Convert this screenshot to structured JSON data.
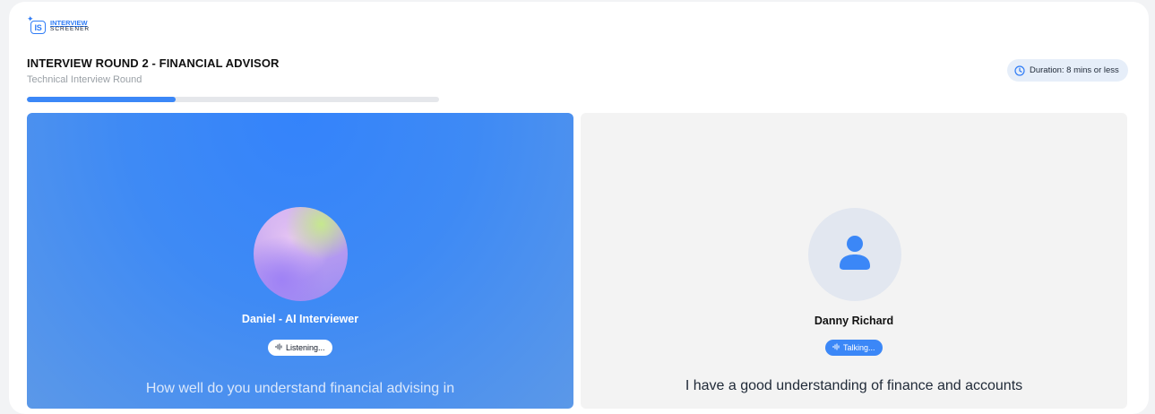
{
  "brand": {
    "logo_mark": "IS",
    "line1": "INTERVIEW",
    "line2": "SCREENER"
  },
  "header": {
    "title": "INTERVIEW ROUND 2 - FINANCIAL ADVISOR",
    "subtitle": "Technical Interview Round",
    "duration": "Duration: 8 mins or less",
    "duration_icon": "clock-icon"
  },
  "progress": {
    "fraction": 0.36,
    "color": "#3b87f7"
  },
  "ai_panel": {
    "name": "Daniel - AI Interviewer",
    "status": "Listening...",
    "status_icon": "audio-wave-icon",
    "question": "How well do you understand financial advising in",
    "background": "#3f8af4"
  },
  "user_panel": {
    "name": "Danny Richard",
    "status": "Talking...",
    "status_icon": "audio-wave-icon",
    "answer": "I have a good understanding of finance and accounts",
    "avatar_icon": "user-icon"
  }
}
